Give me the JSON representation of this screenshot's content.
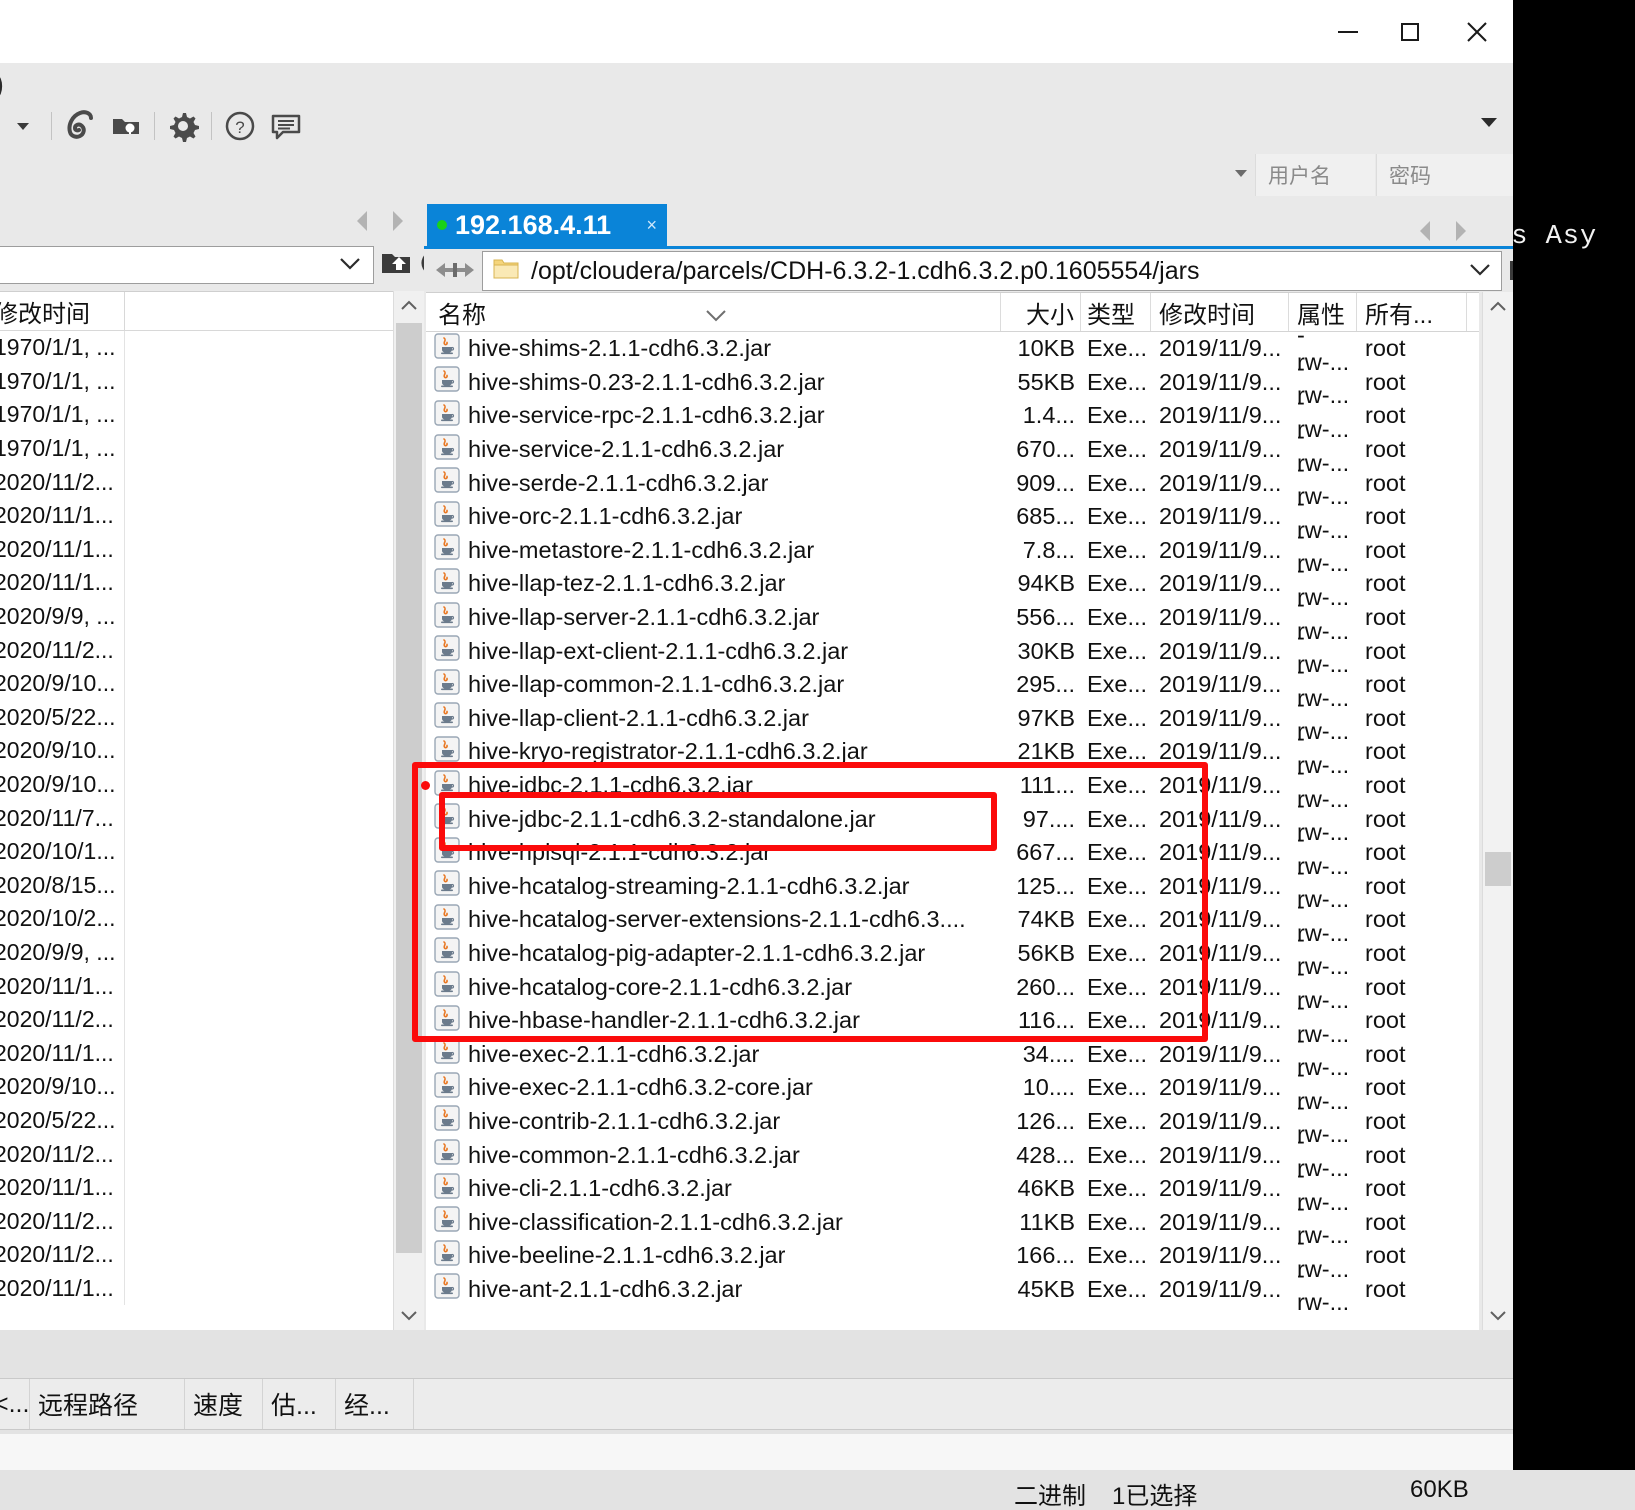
{
  "window": {
    "controls": {
      "minimize": "minimize-button",
      "maximize": "maximize-button",
      "close": "close-button"
    }
  },
  "toolbar": {
    "leading_text": ")",
    "icons": [
      "dropdown-caret-icon",
      "spiral-icon",
      "folder-key-icon",
      "gear-icon",
      "help-icon",
      "chat-icon"
    ],
    "overflow": "▾"
  },
  "credentials": {
    "username_placeholder": "用户名",
    "password_placeholder": "密码"
  },
  "left_panel": {
    "column_header": "修改时间",
    "rows": [
      "1970/1/1, ...",
      "1970/1/1, ...",
      "1970/1/1, ...",
      "1970/1/1, ...",
      "2020/11/2...",
      "2020/11/1...",
      "2020/11/1...",
      "2020/11/1...",
      "2020/9/9, ...",
      "2020/11/2...",
      "2020/9/10...",
      "2020/5/22...",
      "2020/9/10...",
      "2020/9/10...",
      "2020/11/7...",
      "2020/10/1...",
      "2020/8/15...",
      "2020/10/2...",
      "2020/9/9, ...",
      "2020/11/1...",
      "2020/11/2...",
      "2020/11/1...",
      "2020/9/10...",
      "2020/5/22...",
      "2020/11/2...",
      "2020/11/1...",
      "2020/11/2...",
      "2020/11/2...",
      "2020/11/1..."
    ]
  },
  "remote_pane": {
    "tab": {
      "label": "192.168.4.11",
      "status_dot": "green",
      "close": "×"
    },
    "path": "/opt/cloudera/parcels/CDH-6.3.2-1.cdh6.3.2.p0.1605554/jars",
    "columns": [
      "名称",
      "大小",
      "类型",
      "修改时间",
      "属性",
      "所有..."
    ],
    "files": [
      {
        "name": "hive-shims-2.1.1-cdh6.3.2.jar",
        "size": "10KB",
        "type": "Exe...",
        "mtime": "2019/11/9...",
        "attr": "-rw-...",
        "owner": "root"
      },
      {
        "name": "hive-shims-0.23-2.1.1-cdh6.3.2.jar",
        "size": "55KB",
        "type": "Exe...",
        "mtime": "2019/11/9...",
        "attr": "-rw-...",
        "owner": "root"
      },
      {
        "name": "hive-service-rpc-2.1.1-cdh6.3.2.jar",
        "size": "1.4...",
        "type": "Exe...",
        "mtime": "2019/11/9...",
        "attr": "-rw-...",
        "owner": "root"
      },
      {
        "name": "hive-service-2.1.1-cdh6.3.2.jar",
        "size": "670...",
        "type": "Exe...",
        "mtime": "2019/11/9...",
        "attr": "-rw-...",
        "owner": "root"
      },
      {
        "name": "hive-serde-2.1.1-cdh6.3.2.jar",
        "size": "909...",
        "type": "Exe...",
        "mtime": "2019/11/9...",
        "attr": "-rw-...",
        "owner": "root"
      },
      {
        "name": "hive-orc-2.1.1-cdh6.3.2.jar",
        "size": "685...",
        "type": "Exe...",
        "mtime": "2019/11/9...",
        "attr": "-rw-...",
        "owner": "root"
      },
      {
        "name": "hive-metastore-2.1.1-cdh6.3.2.jar",
        "size": "7.8...",
        "type": "Exe...",
        "mtime": "2019/11/9...",
        "attr": "-rw-...",
        "owner": "root"
      },
      {
        "name": "hive-llap-tez-2.1.1-cdh6.3.2.jar",
        "size": "94KB",
        "type": "Exe...",
        "mtime": "2019/11/9...",
        "attr": "-rw-...",
        "owner": "root"
      },
      {
        "name": "hive-llap-server-2.1.1-cdh6.3.2.jar",
        "size": "556...",
        "type": "Exe...",
        "mtime": "2019/11/9...",
        "attr": "-rw-...",
        "owner": "root"
      },
      {
        "name": "hive-llap-ext-client-2.1.1-cdh6.3.2.jar",
        "size": "30KB",
        "type": "Exe...",
        "mtime": "2019/11/9...",
        "attr": "-rw-...",
        "owner": "root"
      },
      {
        "name": "hive-llap-common-2.1.1-cdh6.3.2.jar",
        "size": "295...",
        "type": "Exe...",
        "mtime": "2019/11/9...",
        "attr": "-rw-...",
        "owner": "root"
      },
      {
        "name": "hive-llap-client-2.1.1-cdh6.3.2.jar",
        "size": "97KB",
        "type": "Exe...",
        "mtime": "2019/11/9...",
        "attr": "-rw-...",
        "owner": "root"
      },
      {
        "name": "hive-kryo-registrator-2.1.1-cdh6.3.2.jar",
        "size": "21KB",
        "type": "Exe...",
        "mtime": "2019/11/9...",
        "attr": "-rw-...",
        "owner": "root"
      },
      {
        "name": "hive-jdbc-2.1.1-cdh6.3.2.jar",
        "size": "111...",
        "type": "Exe...",
        "mtime": "2019/11/9...",
        "attr": "-rw-...",
        "owner": "root"
      },
      {
        "name": "hive-jdbc-2.1.1-cdh6.3.2-standalone.jar",
        "size": "97....",
        "type": "Exe...",
        "mtime": "2019/11/9...",
        "attr": "-rw-...",
        "owner": "root"
      },
      {
        "name": "hive-hplsql-2.1.1-cdh6.3.2.jar",
        "size": "667...",
        "type": "Exe...",
        "mtime": "2019/11/9...",
        "attr": "-rw-...",
        "owner": "root"
      },
      {
        "name": "hive-hcatalog-streaming-2.1.1-cdh6.3.2.jar",
        "size": "125...",
        "type": "Exe...",
        "mtime": "2019/11/9...",
        "attr": "-rw-...",
        "owner": "root"
      },
      {
        "name": "hive-hcatalog-server-extensions-2.1.1-cdh6.3....",
        "size": "74KB",
        "type": "Exe...",
        "mtime": "2019/11/9...",
        "attr": "-rw-...",
        "owner": "root"
      },
      {
        "name": "hive-hcatalog-pig-adapter-2.1.1-cdh6.3.2.jar",
        "size": "56KB",
        "type": "Exe...",
        "mtime": "2019/11/9...",
        "attr": "-rw-...",
        "owner": "root"
      },
      {
        "name": "hive-hcatalog-core-2.1.1-cdh6.3.2.jar",
        "size": "260...",
        "type": "Exe...",
        "mtime": "2019/11/9...",
        "attr": "-rw-...",
        "owner": "root"
      },
      {
        "name": "hive-hbase-handler-2.1.1-cdh6.3.2.jar",
        "size": "116...",
        "type": "Exe...",
        "mtime": "2019/11/9...",
        "attr": "-rw-...",
        "owner": "root"
      },
      {
        "name": "hive-exec-2.1.1-cdh6.3.2.jar",
        "size": "34....",
        "type": "Exe...",
        "mtime": "2019/11/9...",
        "attr": "-rw-...",
        "owner": "root"
      },
      {
        "name": "hive-exec-2.1.1-cdh6.3.2-core.jar",
        "size": "10....",
        "type": "Exe...",
        "mtime": "2019/11/9...",
        "attr": "-rw-...",
        "owner": "root"
      },
      {
        "name": "hive-contrib-2.1.1-cdh6.3.2.jar",
        "size": "126...",
        "type": "Exe...",
        "mtime": "2019/11/9...",
        "attr": "-rw-...",
        "owner": "root"
      },
      {
        "name": "hive-common-2.1.1-cdh6.3.2.jar",
        "size": "428...",
        "type": "Exe...",
        "mtime": "2019/11/9...",
        "attr": "-rw-...",
        "owner": "root"
      },
      {
        "name": "hive-cli-2.1.1-cdh6.3.2.jar",
        "size": "46KB",
        "type": "Exe...",
        "mtime": "2019/11/9...",
        "attr": "-rw-...",
        "owner": "root"
      },
      {
        "name": "hive-classification-2.1.1-cdh6.3.2.jar",
        "size": "11KB",
        "type": "Exe...",
        "mtime": "2019/11/9...",
        "attr": "-rw-...",
        "owner": "root"
      },
      {
        "name": "hive-beeline-2.1.1-cdh6.3.2.jar",
        "size": "166...",
        "type": "Exe...",
        "mtime": "2019/11/9...",
        "attr": "-rw-...",
        "owner": "root"
      },
      {
        "name": "hive-ant-2.1.1-cdh6.3.2.jar",
        "size": "45KB",
        "type": "Exe...",
        "mtime": "2019/11/9...",
        "attr": "-rw-...",
        "owner": "root"
      }
    ]
  },
  "transfer_queue": {
    "columns": [
      "<...",
      "远程路径",
      "速度",
      "估...",
      "经...",
      ""
    ]
  },
  "status_bar": {
    "encoding": "二进制",
    "selection": "1已选择",
    "size": "60KB"
  },
  "terminal_backdrop": {
    "text": "es Asy"
  },
  "annotation": {
    "highlight_color": "#fb0b0b",
    "outer_box_label": "highlighted-file-group",
    "inner_box_label": "highlighted-target-file",
    "inner_box_target": "hive-jdbc-2.1.1-cdh6.3.2-standalone.jar"
  }
}
